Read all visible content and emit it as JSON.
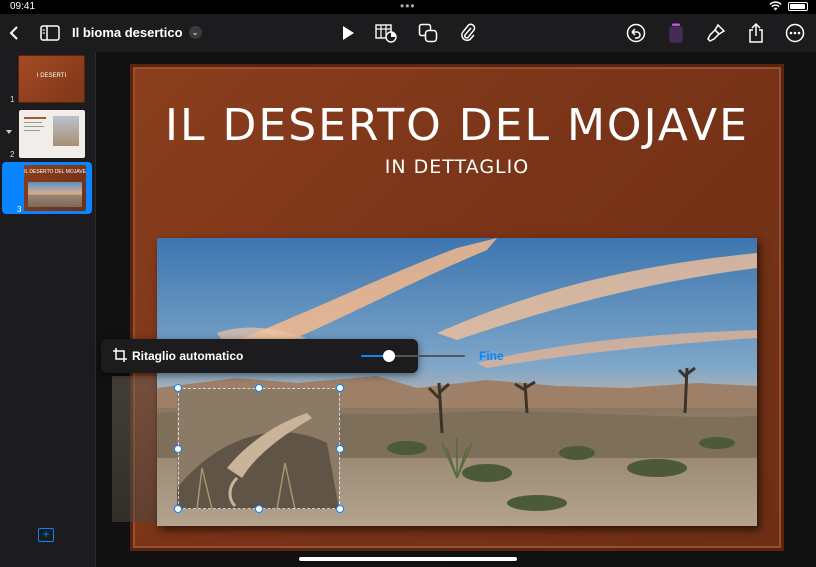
{
  "status_bar": {
    "time": "09:41",
    "dots": "•••",
    "wifi_icon": "wifi-icon",
    "battery_icon": "battery-icon"
  },
  "toolbar": {
    "back_icon": "chevron-left-icon",
    "sidebar_icon": "sidebar-icon",
    "title": "Il bioma desertico",
    "title_chevron": "⌄",
    "play_icon": "play-icon",
    "table_chart_icon": "table-chart-icon",
    "shapes_icon": "shapes-icon",
    "attachment_icon": "paperclip-icon",
    "undo_icon": "undo-icon",
    "format_icon": "format-icon",
    "brush_icon": "brush-icon",
    "share_icon": "share-icon",
    "more_icon": "more-icon",
    "accent": "#bf5af2"
  },
  "navigator": {
    "slides": [
      {
        "number": "1",
        "title": "I DESERTI"
      },
      {
        "number": "2",
        "title": ""
      },
      {
        "number": "3",
        "title": "IL DESERTO DEL MOJAVE"
      }
    ],
    "selected_index": 2,
    "add_label": "+"
  },
  "slide": {
    "title": "IL DESERTO DEL MOJAVE",
    "subtitle": "IN DETTAGLIO"
  },
  "crop_bar": {
    "label": "Ritaglio automatico",
    "done_label": "Fine",
    "slider_value": 0.27
  },
  "colors": {
    "accent_blue": "#0a84ff",
    "slide_bg": "#7a3418"
  }
}
